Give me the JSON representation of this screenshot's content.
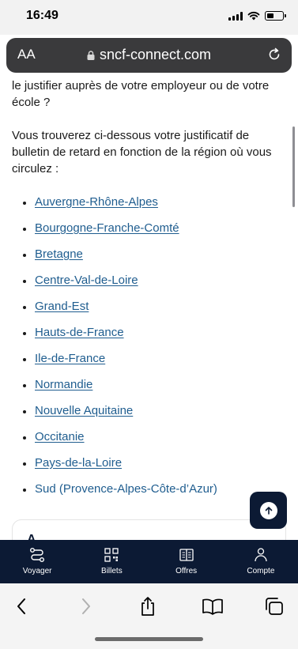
{
  "status_bar": {
    "time": "16:49"
  },
  "url_bar": {
    "text_size_label": "AA",
    "host": "sncf-connect.com"
  },
  "content": {
    "intro_paragraph": "le justifier auprès de votre employeur ou de votre école ?",
    "body_paragraph": "Vous trouverez ci-dessous votre justificatif de bulletin de retard en fonction de la région où vous circulez :",
    "regions": [
      {
        "label": "Auvergne-Rhône-Alpes",
        "linked": true
      },
      {
        "label": "Bourgogne-Franche-Comté",
        "linked": true
      },
      {
        "label": "Bretagne",
        "linked": true
      },
      {
        "label": "Centre-Val-de-Loire",
        "linked": true
      },
      {
        "label": "Grand-Est",
        "linked": true
      },
      {
        "label": "Hauts-de-France",
        "linked": true
      },
      {
        "label": "Ile-de-France",
        "linked": true
      },
      {
        "label": "Normandie",
        "linked": true
      },
      {
        "label": "Nouvelle Aquitaine",
        "linked": true
      },
      {
        "label": "Occitanie",
        "linked": true
      },
      {
        "label": "Pays-de-la-Loire",
        "linked": true
      },
      {
        "label": "Sud (Provence-Alpes-Côte-d’Azur)",
        "linked": false
      }
    ],
    "teaser_text": "A …"
  },
  "app_nav": {
    "items": [
      {
        "label": "Voyager",
        "icon": "route-icon"
      },
      {
        "label": "Billets",
        "icon": "qr-code-icon"
      },
      {
        "label": "Offres",
        "icon": "book-icon"
      },
      {
        "label": "Compte",
        "icon": "user-icon"
      }
    ]
  },
  "colors": {
    "nav_background": "#0c1a34",
    "link": "#1f5d8f",
    "url_bar": "#3a3a3c"
  }
}
